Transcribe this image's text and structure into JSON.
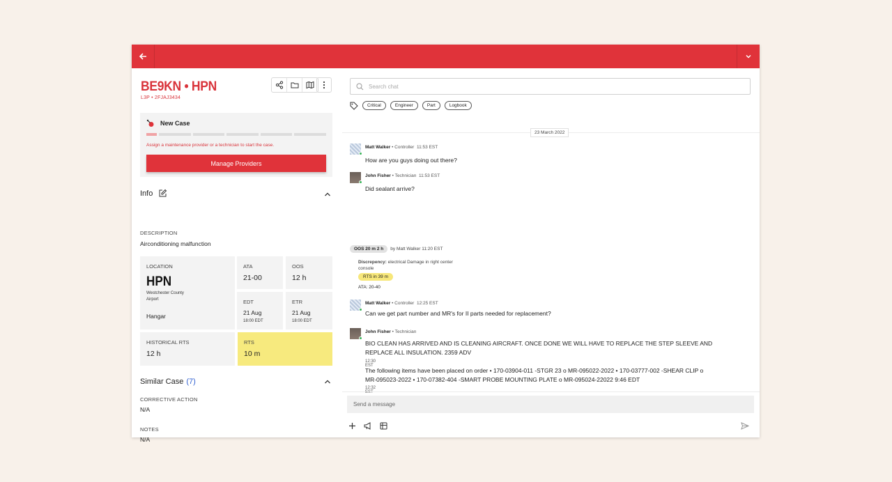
{
  "header": {
    "title": "BE9KN • HPN",
    "subtitle": "L3P • 2FJAJ3434"
  },
  "case": {
    "status": "New Case",
    "message": "Assign a maintenance provider or a technician to start the case.",
    "manage_label": "Manage Providers"
  },
  "info": {
    "heading": "Info",
    "description_label": "DESCRIPTION",
    "description_value": "Airconditioning malfunction",
    "location_label": "LOCATION",
    "location_code": "HPN",
    "location_name_line1": "Westchester County",
    "location_name_line2": "Airport",
    "location_place": "Hangar",
    "ata_label": "ATA",
    "ata_value": "21-00",
    "oos_label": "OOS",
    "oos_value": "12 h",
    "edt_label": "EDT",
    "edt_value": "21 Aug",
    "edt_time": "18:00 EDT",
    "etr_label": "ETR",
    "etr_value": "21 Aug",
    "etr_time": "18:00 EDT",
    "hist_label": "HISTORICAL RTS",
    "hist_value": "12 h",
    "rts_label": "RTS",
    "rts_value": "10 m"
  },
  "similar": {
    "heading": "Similar Case",
    "count": "(7)",
    "corrective_label": "CORRECTIVE ACTION",
    "corrective_value": "N/A",
    "notes_label": "NOTES",
    "notes_value": "N/A"
  },
  "chat": {
    "search_placeholder": "Search chat",
    "tags": [
      "Critical",
      "Engineer",
      "Part",
      "Logbook"
    ],
    "date": "23 March 2022",
    "messages": [
      {
        "name": "Matt Walker",
        "role": "• Controller",
        "time": "11:53 EST",
        "text": "How are you guys doing out there?"
      },
      {
        "name": "John Fisher",
        "role": "• Technician",
        "time": "11:53 EST",
        "text": "Did sealant arrive?"
      },
      {
        "name": "Matt Walker",
        "role": "• Controller",
        "time": "12:25 EST",
        "text": "Can we get part number and MR's for II parts needed for replacement?"
      },
      {
        "name": "John Fisher",
        "role": "• Technician",
        "time": "",
        "text1": "BIO CLEAN HAS ARRIVED AND IS CLEANING AIRCRAFT. ONCE DONE WE WILL HAVE TO REPLACE THE STEP SLEEVE AND",
        "text2": "REPLACE ALL INSULATION. 2359 ADV",
        "ts1": "12:30 EST",
        "text3": "The following items have been placed on order • 170-03904-011 -STGR 23 o MR-095022-2022 • 170-03777-002 -SHEAR CLIP o",
        "text4": "MR-095023-2022 • 170-07382-404 -SMART PROBE MOUNTING PLATE o MR-095024-22022  9:46 EDT",
        "ts2": "12:32 EST"
      }
    ],
    "event": {
      "oos": "OOS 20 m 2 h",
      "by": "by Matt Walker 11:20 EST",
      "disc_label": "Discrepency:",
      "disc_text": "electrical Damage in right center console",
      "rts": "RTS in 39 m",
      "ata": "ATA: 20-40"
    },
    "composer_placeholder": "Send a message"
  },
  "colors": {
    "brand": "#e0333a",
    "highlight": "#f7ea7e",
    "online": "#3bb55b"
  }
}
